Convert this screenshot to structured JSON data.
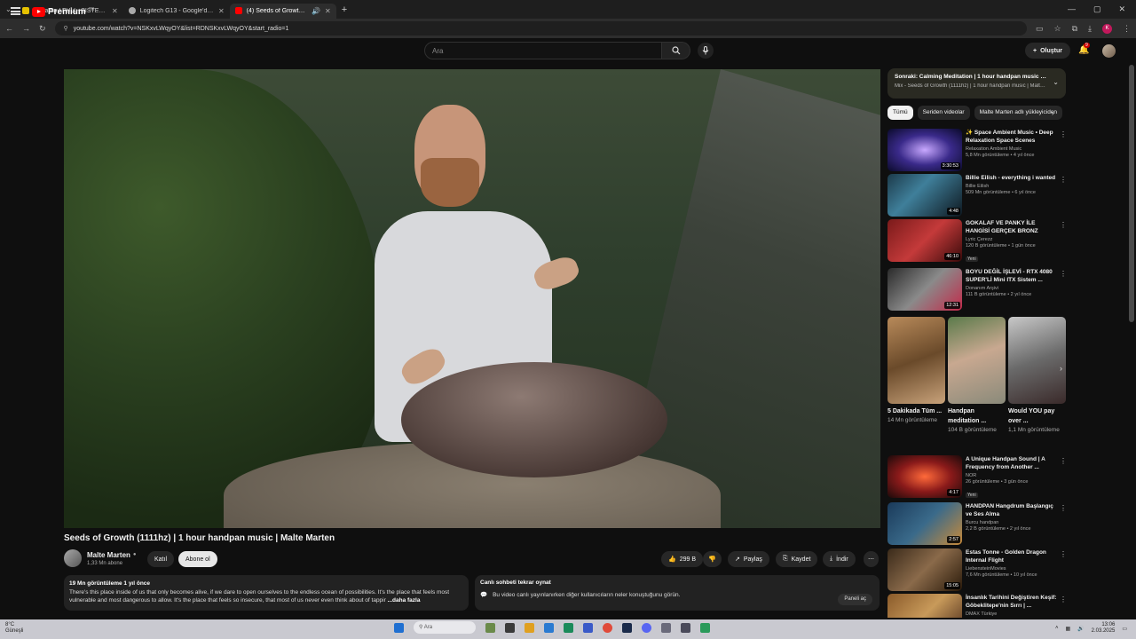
{
  "browser": {
    "tabs": [
      {
        "label": "Toplama / FULL+SİSTEM sahibi",
        "active": false,
        "color": "#e5c100"
      },
      {
        "label": "Logitech G13 - Google'da Ara",
        "active": false,
        "color": "#aaaaaa"
      },
      {
        "label": "(4) Seeds of Growth (1111hz)",
        "active": true,
        "color": "#ff0000"
      }
    ],
    "url": "youtube.com/watch?v=NSKxvLWqyOY&list=RDNSKxvLWqyOY&start_radio=1"
  },
  "header": {
    "logo_text": "Premium",
    "logo_sup": "TR",
    "search_placeholder": "Ara",
    "create_label": "Oluştur",
    "notif_count": "9"
  },
  "video": {
    "title": "Seeds of Growth (1111hz) | 1 hour handpan music | Malte Marten",
    "channel": "Malte Marten",
    "subscribers": "1,33 Mn abone",
    "join_label": "Katıl",
    "subscribe_label": "Abone ol",
    "likes": "299 B",
    "share_label": "Paylaş",
    "save_label": "Kaydet",
    "download_label": "İndir",
    "views_time": "19 Mn görüntüleme  1 yıl önce",
    "description": "There's this place inside of us that only becomes alive, if we dare to open ourselves to the endless ocean of possibilities. It's the place that feels most vulnerable and most dangerous to allow. It's the place that feels so insecure, that most of us never even think about of tappir",
    "more_label": "...daha fazla"
  },
  "chat": {
    "title": "Canlı sohbeti tekrar oynat",
    "text": "Bu video canlı yayınlanırken diğer kullanıcıların neler konuştuğunu görün.",
    "open_label": "Paneli aç"
  },
  "up_next": {
    "title": "Sonraki: Calming Meditation | 1 hour handpan music | Malte Marten",
    "subtitle": "Mix - Seeds of Growth (1111hz) | 1 hour handpan music | Malte Marten"
  },
  "chips": [
    "Tümü",
    "Seriden videolar",
    "Malte Marten adlı yükleyiciden"
  ],
  "recs_top": [
    {
      "title": "✨ Space Ambient Music • Deep Relaxation Space Scenes",
      "channel": "Relaxation Ambient Music",
      "views": "5,8 Mn görüntüleme • 4 yıl önce",
      "duration": "3:30:53",
      "new": ""
    },
    {
      "title": "Billie Eilish - everything i wanted",
      "channel": "Billie Eilish",
      "views": "509 Mn görüntüleme • 6 yıl önce",
      "duration": "4:48",
      "new": ""
    },
    {
      "title": "GOKALAF VE PANKY İLE HANGİSİ GERÇEK BRONZ",
      "channel": "Lyric Çerezz",
      "views": "120 B görüntüleme • 1 gün önce",
      "duration": "46:10",
      "new": "Yeni"
    },
    {
      "title": "BOYU DEĞİL İŞLEVİ - RTX 4080 SUPER'Lİ Mini ITX Sistem ...",
      "channel": "Donanım Arşivi",
      "views": "111 B görüntüleme • 2 yıl önce",
      "duration": "12:31",
      "new": ""
    }
  ],
  "shorts": [
    {
      "title": "5 Dakikada Tüm ...",
      "views": "14 Mn görüntüleme"
    },
    {
      "title": "Handpan meditation ...",
      "views": "104 B görüntüleme"
    },
    {
      "title": "Would YOU pay over ...",
      "views": "1,1 Mn görüntüleme"
    }
  ],
  "recs_bottom": [
    {
      "title": "A Unique Handpan Sound | A Frequency from Another ...",
      "channel": "NOR",
      "views": "26 görüntüleme • 3 gün önce",
      "duration": "4:17",
      "new": "Yeni"
    },
    {
      "title": "HANDPAN Hangdrum Başlangıç ve Ses Alma",
      "channel": "Burcu handpan",
      "views": "2,2 B görüntüleme • 2 yıl önce",
      "duration": "2:57",
      "new": ""
    },
    {
      "title": "Estas Tonne - Golden Dragon Internal Flight",
      "channel": "LiebensteinMovies",
      "views": "7,6 Mn görüntüleme • 10 yıl önce",
      "duration": "15:05",
      "new": ""
    },
    {
      "title": "İnsanlık Tarihini Değiştiren Keşif: Göbeklitepe'nin Sırrı | ...",
      "channel": "DMAX Türkiye",
      "views": "",
      "duration": "",
      "new": ""
    }
  ],
  "taskbar": {
    "weather_temp": "8°C",
    "weather_desc": "Güneşli",
    "search_placeholder": "Ara",
    "time": "13:06",
    "date": "2.03.2025"
  }
}
